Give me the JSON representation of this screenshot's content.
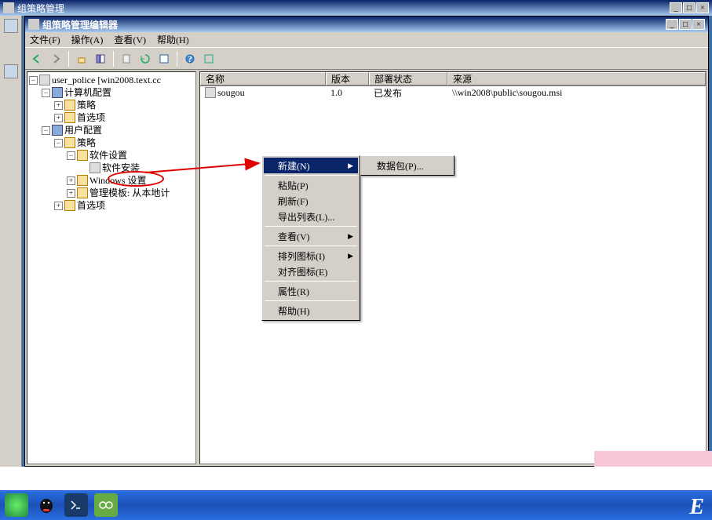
{
  "outer": {
    "title": "组策略管理",
    "min": "_",
    "max": "□",
    "close": "×"
  },
  "editor": {
    "title": "组策略管理编辑器",
    "min": "_",
    "max": "□",
    "close": "×"
  },
  "menubar": {
    "file": "文件(F)",
    "action": "操作(A)",
    "view": "查看(V)",
    "help": "帮助(H)"
  },
  "tree": {
    "root": "user_police [win2008.text.cc",
    "computerCfg": "计算机配置",
    "policies": "策略",
    "prefs": "首选项",
    "userCfg": "用户配置",
    "swSettings": "软件设置",
    "swInstall": "软件安装",
    "winSettings": "Windows 设置",
    "adminTmpl": "管理模板: 从本地计"
  },
  "list": {
    "cols": {
      "name": "名称",
      "version": "版本",
      "deploy": "部署状态",
      "source": "来源"
    },
    "rows": [
      {
        "name": "sougou",
        "version": "1.0",
        "deploy": "已发布",
        "source": "\\\\win2008\\public\\sougou.msi"
      }
    ]
  },
  "ctx": {
    "new": "新建(N)",
    "paste": "粘贴(P)",
    "refresh": "刷新(F)",
    "export": "导出列表(L)...",
    "view": "查看(V)",
    "arrange": "排列图标(I)",
    "align": "对齐图标(E)",
    "props": "属性(R)",
    "help": "帮助(H)"
  },
  "submenu": {
    "package": "数据包(P)..."
  }
}
